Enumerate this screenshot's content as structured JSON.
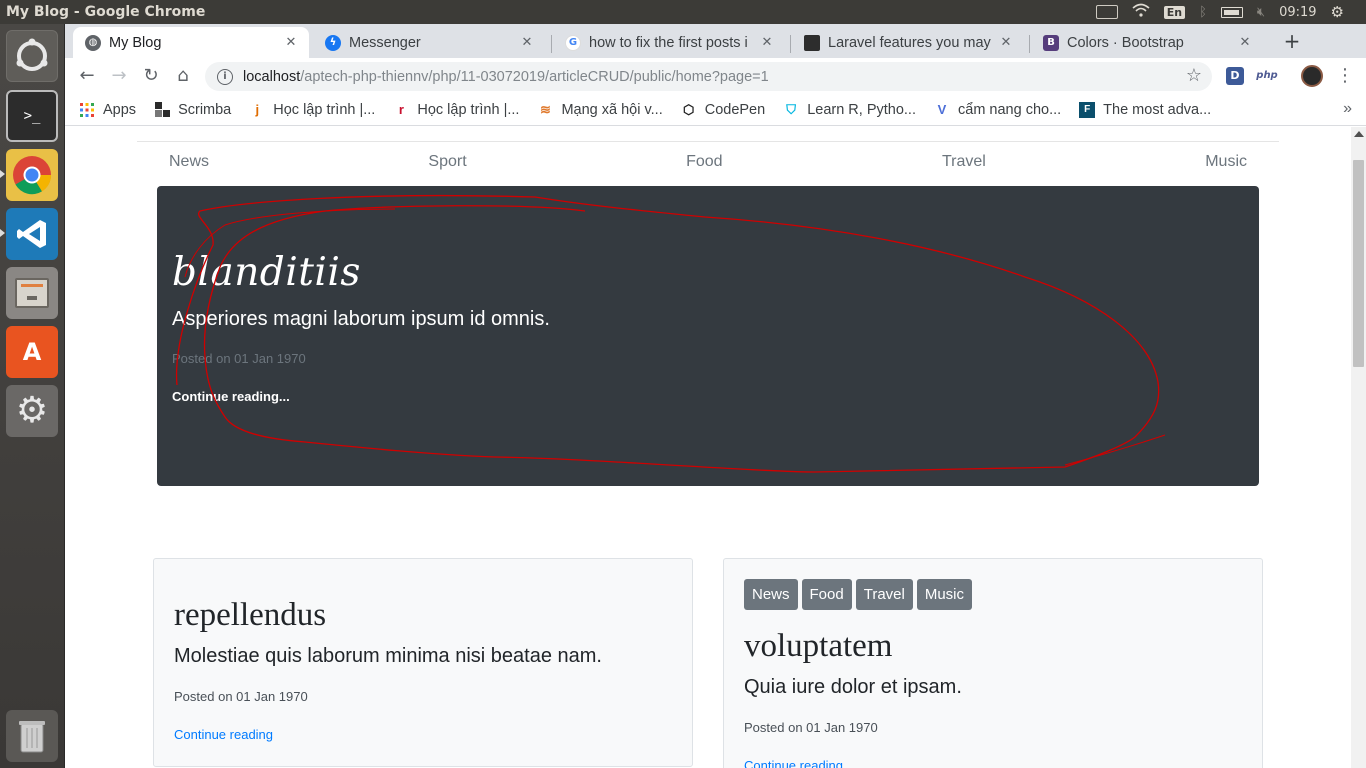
{
  "os": {
    "window_title": "My Blog - Google Chrome",
    "keyboard_layout": "En",
    "clock": "09:19"
  },
  "browser": {
    "tabs": [
      {
        "title": "My Blog",
        "favicon": "globe-icon",
        "active": true
      },
      {
        "title": "Messenger",
        "favicon": "messenger-icon",
        "active": false
      },
      {
        "title": "how to fix the first posts i",
        "favicon": "google-icon",
        "active": false
      },
      {
        "title": "Laravel features you may n",
        "favicon": "laravel-site-icon",
        "active": false
      },
      {
        "title": "Colors · Bootstrap",
        "favicon": "bootstrap-icon",
        "active": false
      }
    ],
    "url_host": "localhost",
    "url_path": "/aptech-php-thiennv/php/11-03072019/articleCRUD/public/home?page=1",
    "extensions": [
      "D",
      "php"
    ],
    "bookmarks": [
      {
        "label": "Apps",
        "icon": "apps-grid-icon"
      },
      {
        "label": "Scrimba",
        "icon": "scrimba-icon"
      },
      {
        "label": "Học lập trình |...",
        "icon": "j-icon"
      },
      {
        "label": "Học lập trình |...",
        "icon": "f8-icon"
      },
      {
        "label": "Mạng xã hội v...",
        "icon": "viblo-icon"
      },
      {
        "label": "CodePen",
        "icon": "codepen-icon"
      },
      {
        "label": "Learn R, Pytho...",
        "icon": "datacamp-icon"
      },
      {
        "label": "cẩm nang cho...",
        "icon": "v-icon"
      },
      {
        "label": "The most adva...",
        "icon": "f-icon"
      }
    ],
    "bookmarks_more": "»"
  },
  "page": {
    "nav": [
      "News",
      "Sport",
      "Food",
      "Travel",
      "Music"
    ],
    "featured": {
      "title": "blanditiis",
      "lead": "Asperiores magni laborum ipsum id omnis.",
      "meta": "Posted on 01 Jan 1970",
      "link": "Continue reading..."
    },
    "posts": [
      {
        "badges": [],
        "title": "repellendus",
        "lead": "Molestiae quis laborum minima nisi beatae nam.",
        "meta": "Posted on 01 Jan 1970",
        "link": "Continue reading"
      },
      {
        "badges": [
          "News",
          "Food",
          "Travel",
          "Music"
        ],
        "title": "voluptatem",
        "lead": "Quia iure dolor et ipsam.",
        "meta": "Posted on 01 Jan 1970",
        "link": "Continue reading"
      }
    ]
  },
  "colors": {
    "jumbotron": "#343a40",
    "link": "#007bff",
    "badge": "#6c757d",
    "annotation": "#d00000"
  }
}
